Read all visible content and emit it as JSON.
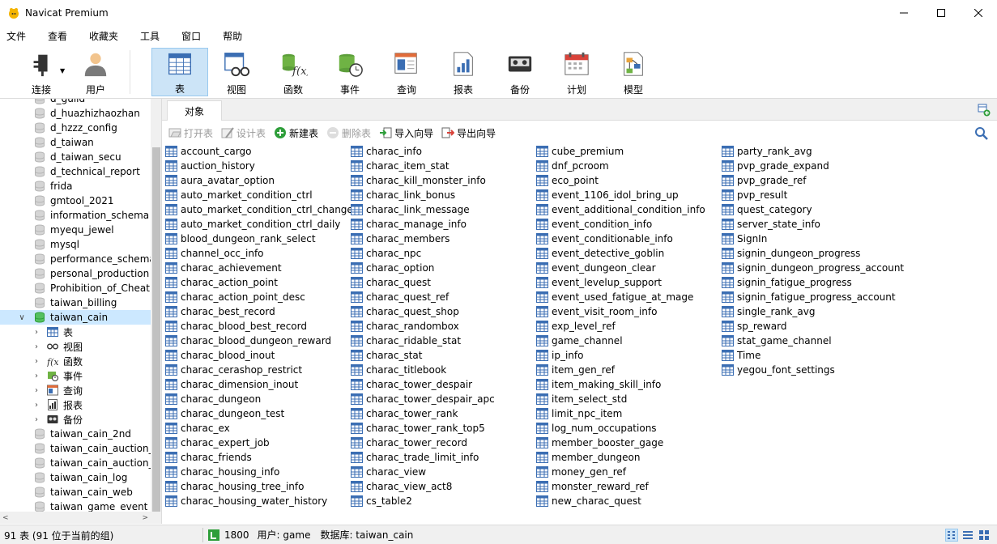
{
  "window": {
    "title": "Navicat Premium"
  },
  "menu": [
    "文件",
    "查看",
    "收藏夹",
    "工具",
    "窗口",
    "帮助"
  ],
  "toolbar": {
    "connect_label": "连接",
    "user_label": "用户",
    "buttons": [
      {
        "label": "表",
        "icon": "table-icon",
        "active": true
      },
      {
        "label": "视图",
        "icon": "view-icon"
      },
      {
        "label": "函数",
        "icon": "function-icon"
      },
      {
        "label": "事件",
        "icon": "event-icon"
      },
      {
        "label": "查询",
        "icon": "query-icon"
      },
      {
        "label": "报表",
        "icon": "report-icon"
      },
      {
        "label": "备份",
        "icon": "backup-icon"
      },
      {
        "label": "计划",
        "icon": "schedule-icon"
      },
      {
        "label": "模型",
        "icon": "model-icon"
      }
    ]
  },
  "tree": {
    "items": [
      {
        "label": "d_guild",
        "type": "db"
      },
      {
        "label": "d_huazhizhaozhan",
        "type": "db"
      },
      {
        "label": "d_hzzz_config",
        "type": "db"
      },
      {
        "label": "d_taiwan",
        "type": "db"
      },
      {
        "label": "d_taiwan_secu",
        "type": "db"
      },
      {
        "label": "d_technical_report",
        "type": "db"
      },
      {
        "label": "frida",
        "type": "db"
      },
      {
        "label": "gmtool_2021",
        "type": "db"
      },
      {
        "label": "information_schema",
        "type": "db"
      },
      {
        "label": "myequ_jewel",
        "type": "db"
      },
      {
        "label": "mysql",
        "type": "db"
      },
      {
        "label": "performance_schema",
        "type": "db"
      },
      {
        "label": "personal_production",
        "type": "db"
      },
      {
        "label": "Prohibition_of_Cheating",
        "type": "db"
      },
      {
        "label": "taiwan_billing",
        "type": "db"
      },
      {
        "label": "taiwan_cain",
        "type": "db-open"
      },
      {
        "label": "表",
        "type": "child",
        "icon": "table-icon"
      },
      {
        "label": "视图",
        "type": "child",
        "icon": "view-icon"
      },
      {
        "label": "函数",
        "type": "child",
        "icon": "function-icon"
      },
      {
        "label": "事件",
        "type": "child",
        "icon": "event-icon"
      },
      {
        "label": "查询",
        "type": "child",
        "icon": "query-icon"
      },
      {
        "label": "报表",
        "type": "child",
        "icon": "report-icon"
      },
      {
        "label": "备份",
        "type": "child",
        "icon": "backup-icon"
      },
      {
        "label": "taiwan_cain_2nd",
        "type": "db"
      },
      {
        "label": "taiwan_cain_auction_cera",
        "type": "db"
      },
      {
        "label": "taiwan_cain_auction_gold",
        "type": "db"
      },
      {
        "label": "taiwan_cain_log",
        "type": "db"
      },
      {
        "label": "taiwan_cain_web",
        "type": "db"
      },
      {
        "label": "taiwan_game_event",
        "type": "db"
      }
    ]
  },
  "tabs": {
    "objects_label": "对象"
  },
  "object_toolbar": {
    "open": "打开表",
    "design": "设计表",
    "new": "新建表",
    "delete": "删除表",
    "import": "导入向导",
    "export": "导出向导"
  },
  "tables": [
    [
      "account_cargo",
      "auction_history",
      "aura_avatar_option",
      "auto_market_condition_ctrl",
      "auto_market_condition_ctrl_change",
      "auto_market_condition_ctrl_daily",
      "blood_dungeon_rank_select",
      "channel_occ_info",
      "charac_achievement",
      "charac_action_point",
      "charac_action_point_desc",
      "charac_best_record",
      "charac_blood_best_record",
      "charac_blood_dungeon_reward",
      "charac_blood_inout",
      "charac_cerashop_restrict",
      "charac_dimension_inout",
      "charac_dungeon",
      "charac_dungeon_test",
      "charac_ex",
      "charac_expert_job",
      "charac_friends",
      "charac_housing_info",
      "charac_housing_tree_info",
      "charac_housing_water_history"
    ],
    [
      "charac_info",
      "charac_item_stat",
      "charac_kill_monster_info",
      "charac_link_bonus",
      "charac_link_message",
      "charac_manage_info",
      "charac_members",
      "charac_npc",
      "charac_option",
      "charac_quest",
      "charac_quest_ref",
      "charac_quest_shop",
      "charac_randombox",
      "charac_ridable_stat",
      "charac_stat",
      "charac_titlebook",
      "charac_tower_despair",
      "charac_tower_despair_apc",
      "charac_tower_rank",
      "charac_tower_rank_top5",
      "charac_tower_record",
      "charac_trade_limit_info",
      "charac_view",
      "charac_view_act8",
      "cs_table2"
    ],
    [
      "cube_premium",
      "dnf_pcroom",
      "eco_point",
      "event_1106_idol_bring_up",
      "event_additional_condition_info",
      "event_condition_info",
      "event_conditionable_info",
      "event_detective_goblin",
      "event_dungeon_clear",
      "event_levelup_support",
      "event_used_fatigue_at_mage",
      "event_visit_room_info",
      "exp_level_ref",
      "game_channel",
      "ip_info",
      "item_gen_ref",
      "item_making_skill_info",
      "item_select_std",
      "limit_npc_item",
      "log_num_occupations",
      "member_booster_gage",
      "member_dungeon",
      "money_gen_ref",
      "monster_reward_ref",
      "new_charac_quest"
    ],
    [
      "party_rank_avg",
      "pvp_grade_expand",
      "pvp_grade_ref",
      "pvp_result",
      "quest_category",
      "server_state_info",
      "SignIn",
      "signin_dungeon_progress",
      "signin_dungeon_progress_account",
      "signin_fatigue_progress",
      "signin_fatigue_progress_account",
      "single_rank_avg",
      "sp_reward",
      "stat_game_channel",
      "Time",
      "yegou_font_settings"
    ]
  ],
  "status": {
    "summary": "91 表 (91 位于当前的组)",
    "port": "1800",
    "user": "用户: game",
    "database": "数据库: taiwan_cain"
  },
  "colors": {
    "selected": "#cce8ff",
    "active_tool": "#cce4f7"
  }
}
